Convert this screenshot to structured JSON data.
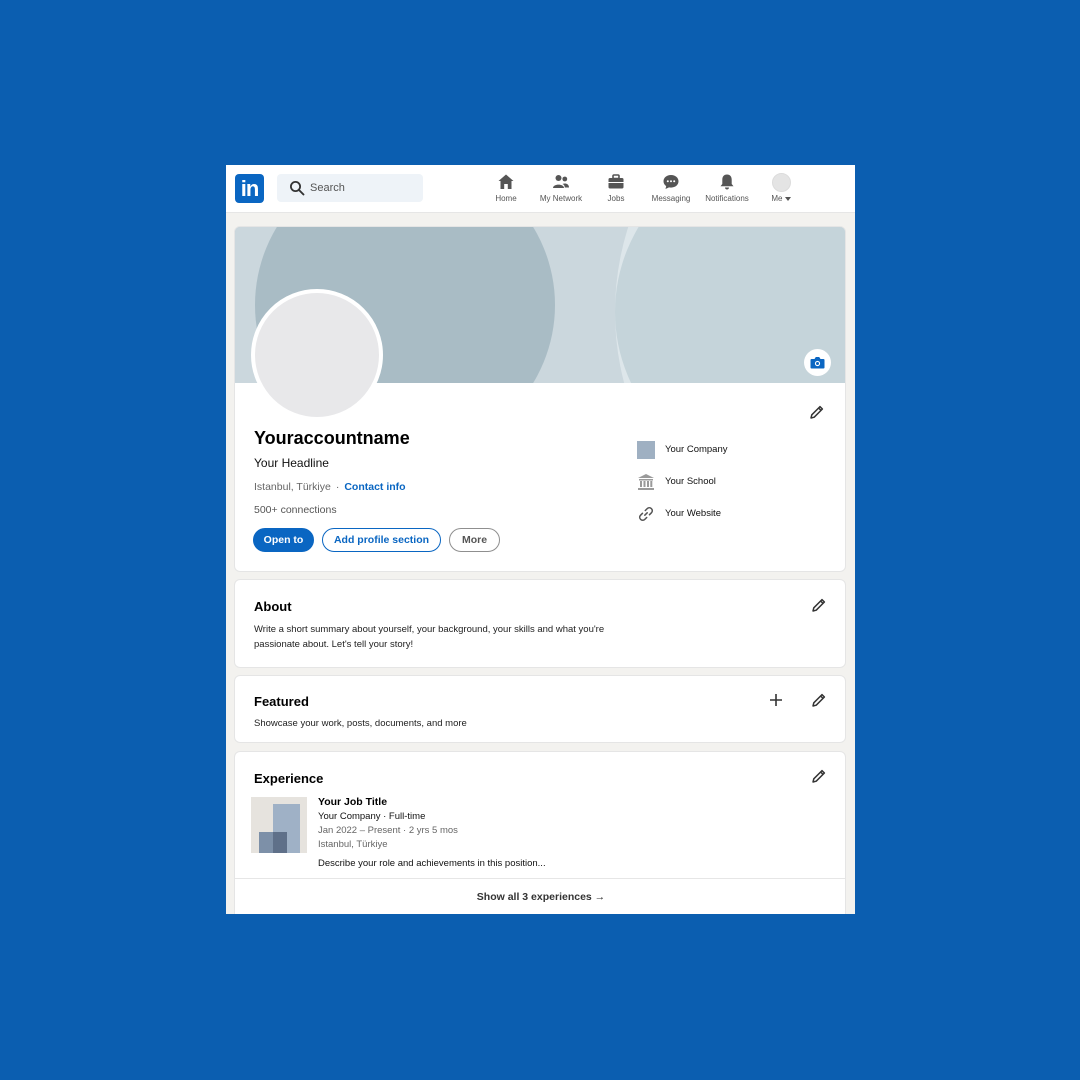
{
  "nav": {
    "logo_text": "in",
    "search_placeholder": "Search",
    "items": [
      {
        "label": "Home",
        "icon": "home-icon"
      },
      {
        "label": "My Network",
        "icon": "network-icon"
      },
      {
        "label": "Jobs",
        "icon": "briefcase-icon"
      },
      {
        "label": "Messaging",
        "icon": "messaging-icon"
      },
      {
        "label": "Notifications",
        "icon": "bell-icon"
      },
      {
        "label": "Me",
        "icon": "avatar"
      }
    ]
  },
  "profile": {
    "name": "Youraccountname",
    "headline": "Your Headline",
    "location": "Istanbul, Türkiye",
    "separator": "·",
    "contact_info": "Contact info",
    "connections": "500+ connections",
    "buttons": {
      "open_to": "Open to",
      "add_section": "Add profile section",
      "more": "More"
    },
    "side": {
      "company": "Your Company",
      "school": "Your School",
      "website": "Your Website"
    }
  },
  "about": {
    "title": "About",
    "text_line1": "Write a short summary about yourself, your background, your skills and what you're",
    "text_line2": "passionate about. Let's tell your story!"
  },
  "featured": {
    "title": "Featured",
    "text": "Showcase your work, posts, documents, and more"
  },
  "experience": {
    "title": "Experience",
    "job_title": "Your Job Title",
    "company_line": "Your Company · Full-time",
    "dates": "Jan 2022 – Present · 2 yrs 5 mos",
    "location": "Istanbul, Türkiye",
    "description": "Describe your role and achievements in this position...",
    "show_all": "Show all 3 experiences →"
  },
  "colors": {
    "brand": "#0a66c2",
    "page_background": "#0b5eb0",
    "cover": "#a9bcc5"
  }
}
